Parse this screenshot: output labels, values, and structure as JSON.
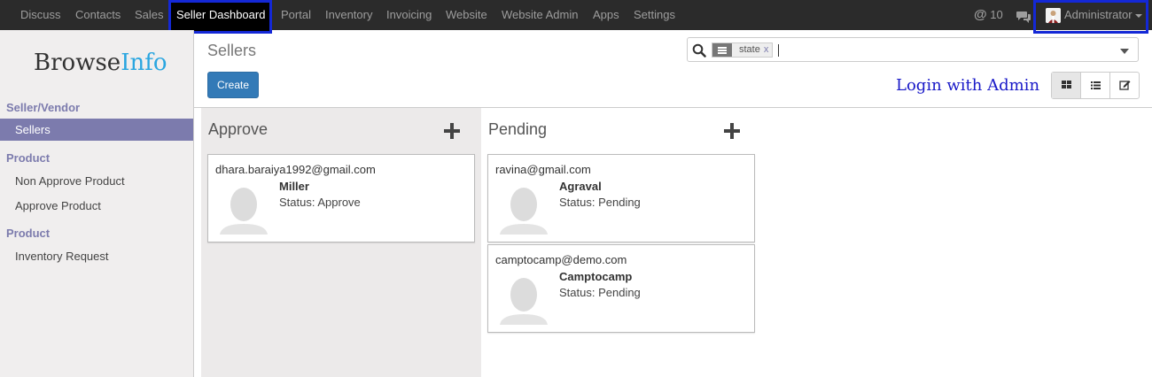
{
  "topbar": {
    "menu": [
      "Discuss",
      "Contacts",
      "Sales",
      "Seller Dashboard",
      "Portal",
      "Inventory",
      "Invoicing",
      "Website",
      "Website Admin",
      "Apps",
      "Settings"
    ],
    "mentions_count": "10",
    "user_name": "Administrator"
  },
  "sidebar": {
    "logo_main": "Browse",
    "logo_accent": "Info",
    "sections": [
      {
        "heading": "Seller/Vendor",
        "items": [
          "Sellers"
        ]
      },
      {
        "heading": "Product",
        "items": [
          "Non Approve Product",
          "Approve Product"
        ]
      },
      {
        "heading": "Product",
        "items": [
          "Inventory Request"
        ]
      }
    ]
  },
  "control_panel": {
    "breadcrumb": "Sellers",
    "create_label": "Create",
    "search_facet": "state",
    "facet_remove": "x",
    "annotation": "Login with Admin"
  },
  "kanban": {
    "columns": [
      {
        "title": "Approve",
        "cards": [
          {
            "email": "dhara.baraiya1992@gmail.com",
            "name": "Miller",
            "status": "Status: Approve"
          }
        ]
      },
      {
        "title": "Pending",
        "cards": [
          {
            "email": "ravina@gmail.com",
            "name": "Agraval",
            "status": "Status: Pending"
          },
          {
            "email": "camptocamp@demo.com",
            "name": "Camptocamp",
            "status": "Status: Pending"
          }
        ]
      }
    ]
  },
  "colors": {
    "navbar": "#2b2b2b",
    "sidebar_accent": "#7c7bad",
    "primary_button": "#337ab7",
    "highlight_box": "#1428d6",
    "annotation_text": "#1a1ac8"
  }
}
